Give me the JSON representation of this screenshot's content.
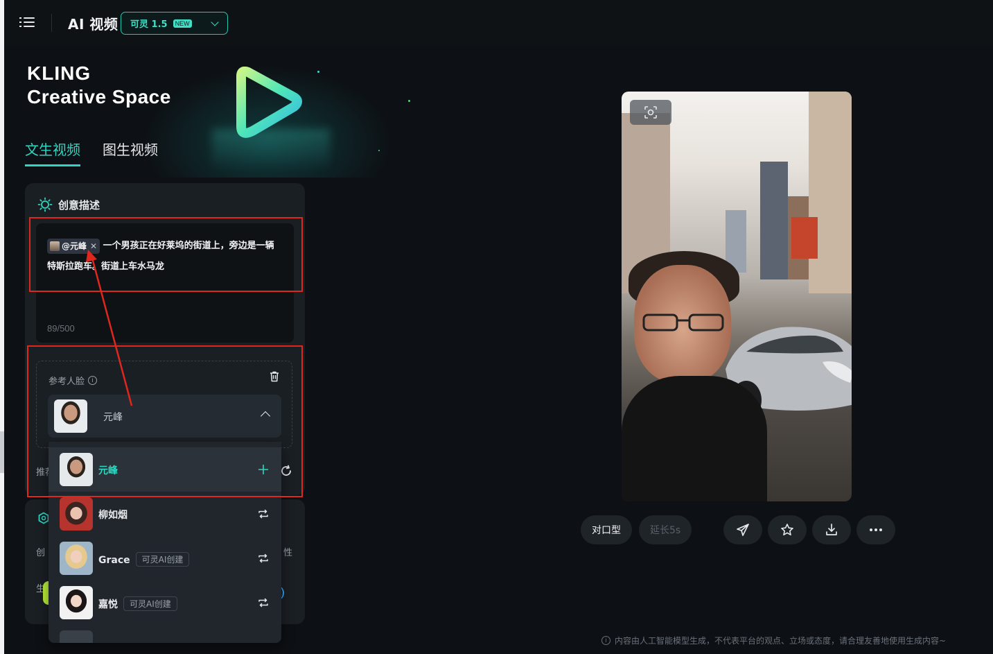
{
  "header": {
    "title": "AI 视频",
    "model_name": "可灵 1.5",
    "model_badge": "NEW"
  },
  "hero": {
    "brand_line1": "KLING",
    "brand_line2": "Creative Space"
  },
  "tabs": [
    {
      "label": "文生视频",
      "active": true
    },
    {
      "label": "图生视频",
      "active": false
    }
  ],
  "creative": {
    "title": "创意描述",
    "mention": "@元峰",
    "prompt_text": "一个男孩正在好莱坞的街道上，旁边是一辆特斯拉跑车。街道上车水马龙",
    "counter": "89/500"
  },
  "reference_face": {
    "label": "参考人脸",
    "selected_name": "元峰"
  },
  "recommend_label": "推荐",
  "panel2": {
    "label_left": "创",
    "label_right": "性",
    "label_bottom": "生"
  },
  "dropdown": {
    "items": [
      {
        "name": "元峰",
        "tag": "",
        "action": "plus-icon"
      },
      {
        "name": "柳如烟",
        "tag": "",
        "action": "swap-icon"
      },
      {
        "name": "Grace",
        "tag": "可灵AI创建",
        "action": "swap-icon"
      },
      {
        "name": "嘉悦",
        "tag": "可灵AI创建",
        "action": "swap-icon"
      }
    ]
  },
  "actions": {
    "lipsync_label": "对口型",
    "extend_label": "延长5s"
  },
  "disclaimer": "内容由人工智能模型生成，不代表平台的观点、立场或态度，请合理友善地使用生成内容~",
  "colors": {
    "accent": "#2fd6c0",
    "background": "#0d1014",
    "panel": "#1a1f24",
    "annotation": "#e0271e"
  }
}
